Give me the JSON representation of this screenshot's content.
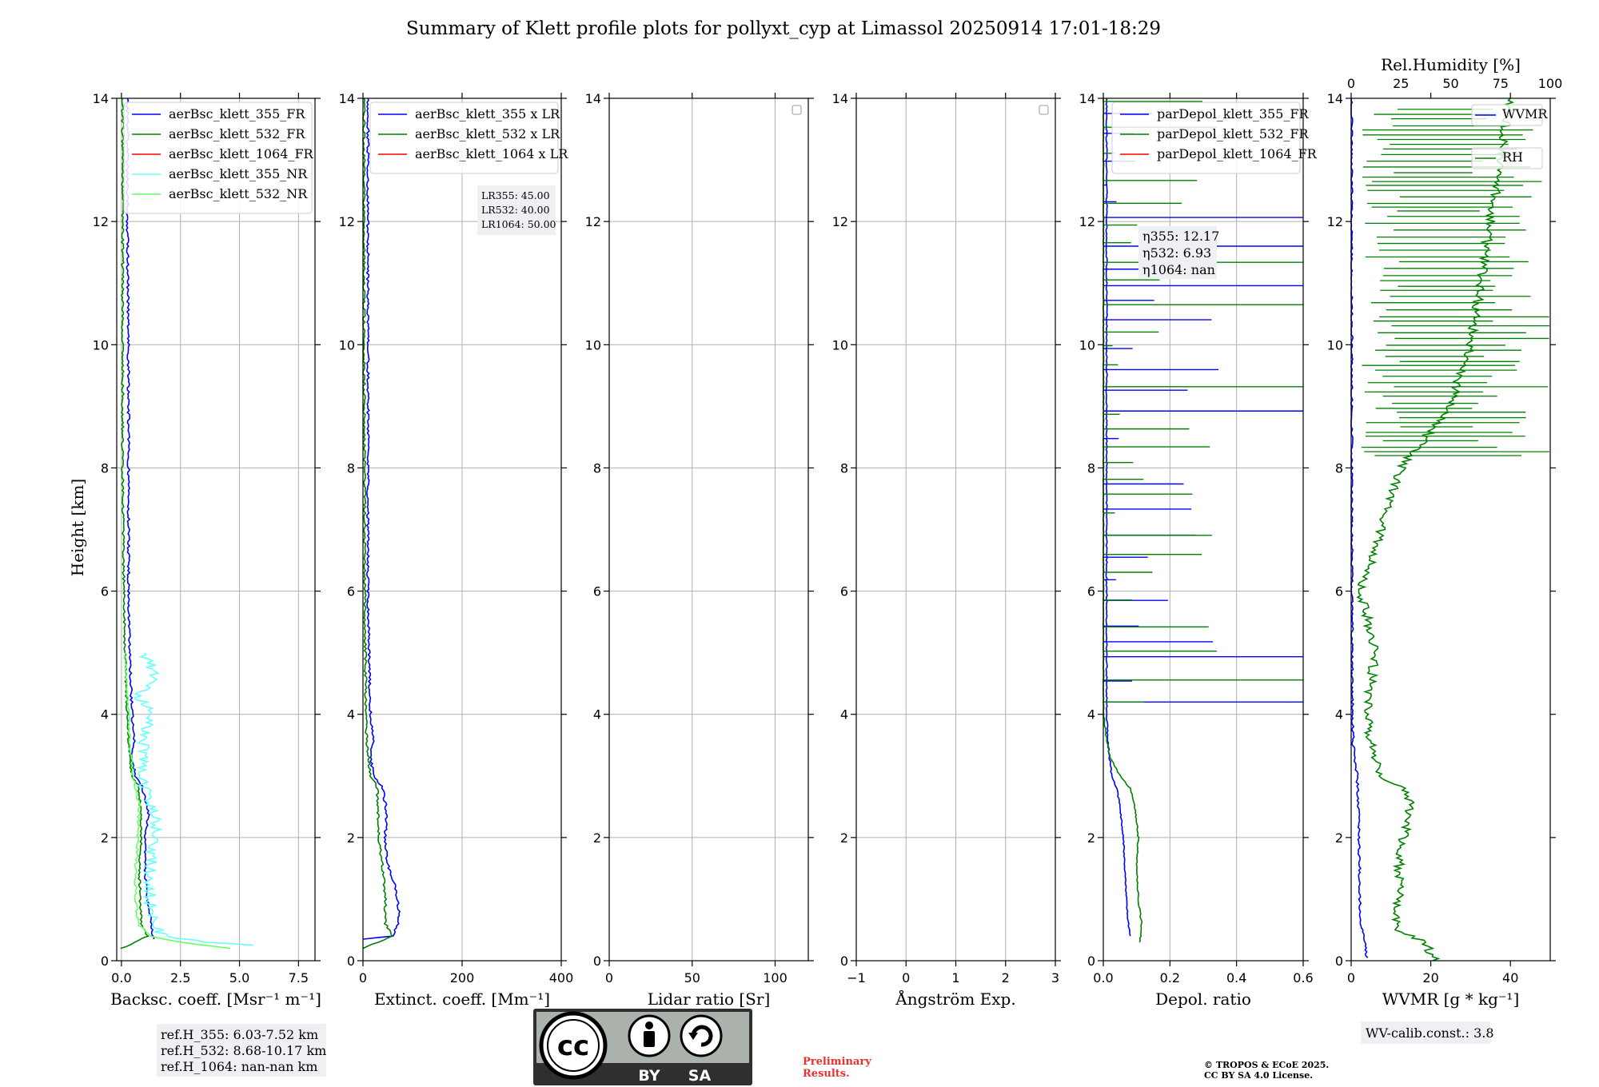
{
  "title": "Summary of Klett profile plots for pollyxt_cyp at Limassol 20250914 17:01-18:29",
  "y_label": "Height [km]",
  "colors": {
    "b355": "#0000ff",
    "b532": "#008000",
    "b1064": "#ff0000",
    "nr355": "#66ffff",
    "nr532": "#66ff66"
  },
  "chart_data": [
    {
      "type": "line",
      "id": "bsc",
      "xlabel": "Backsc. coeff. [Msr⁻¹ m⁻¹]",
      "xlim": [
        -0.2,
        8.2
      ],
      "ylim": [
        0,
        14
      ],
      "grid": true,
      "legend": "top-right",
      "xticks": [
        "0.0",
        "2.5",
        "5.0",
        "7.5"
      ],
      "yticks": [
        "0",
        "2",
        "4",
        "6",
        "8",
        "10",
        "12",
        "14"
      ],
      "series": [
        {
          "name": "aerBsc_klett_355_FR",
          "color": "#0000ff",
          "profile": [
            [
              0.35,
              1.35
            ],
            [
              0.5,
              1.3
            ],
            [
              0.75,
              1.2
            ],
            [
              1.0,
              1.1
            ],
            [
              1.5,
              1.0
            ],
            [
              2.0,
              1.0
            ],
            [
              2.4,
              1.15
            ],
            [
              2.8,
              0.9
            ],
            [
              3.0,
              0.6
            ],
            [
              3.3,
              0.4
            ],
            [
              3.6,
              0.55
            ],
            [
              4.0,
              0.45
            ],
            [
              5.0,
              0.35
            ],
            [
              6.0,
              0.3
            ],
            [
              7.0,
              0.3
            ],
            [
              8.0,
              0.3
            ],
            [
              10.0,
              0.3
            ],
            [
              12.0,
              0.25
            ],
            [
              14.0,
              0.25
            ]
          ]
        },
        {
          "name": "aerBsc_klett_532_FR",
          "color": "#008000",
          "profile": [
            [
              0.2,
              0.0
            ],
            [
              0.3,
              0.6
            ],
            [
              0.4,
              1.1
            ],
            [
              0.6,
              0.85
            ],
            [
              1.0,
              0.8
            ],
            [
              1.5,
              0.75
            ],
            [
              2.0,
              0.85
            ],
            [
              2.5,
              0.8
            ],
            [
              2.85,
              0.7
            ],
            [
              3.0,
              0.45
            ],
            [
              3.5,
              0.3
            ],
            [
              4.0,
              0.25
            ],
            [
              5.0,
              0.15
            ],
            [
              6.0,
              0.1
            ],
            [
              8.0,
              0.05
            ],
            [
              10.0,
              0.05
            ],
            [
              14.0,
              0.05
            ]
          ]
        },
        {
          "name": "aerBsc_klett_1064_FR",
          "color": "#ff0000",
          "profile": []
        },
        {
          "name": "aerBsc_klett_355_NR",
          "color": "#66ffff",
          "profile": [
            [
              0.25,
              5.8
            ],
            [
              0.3,
              3.5
            ],
            [
              0.4,
              1.8
            ],
            [
              0.6,
              1.3
            ],
            [
              1.0,
              1.2
            ],
            [
              1.5,
              1.25
            ],
            [
              2.0,
              1.35
            ],
            [
              2.3,
              1.5
            ],
            [
              2.7,
              1.1
            ],
            [
              3.0,
              0.8
            ],
            [
              3.3,
              1.0
            ],
            [
              3.6,
              0.9
            ],
            [
              4.0,
              1.3
            ],
            [
              4.3,
              0.7
            ],
            [
              4.6,
              1.4
            ],
            [
              5.0,
              1.0
            ]
          ]
        },
        {
          "name": "aerBsc_klett_532_NR",
          "color": "#66ff66",
          "profile": [
            [
              0.2,
              4.6
            ],
            [
              0.3,
              2.5
            ],
            [
              0.4,
              1.2
            ],
            [
              0.6,
              0.7
            ],
            [
              1.0,
              0.6
            ],
            [
              1.5,
              0.6
            ],
            [
              2.0,
              0.7
            ],
            [
              2.5,
              0.75
            ],
            [
              3.0,
              0.5
            ],
            [
              3.5,
              0.35
            ],
            [
              4.0,
              0.3
            ],
            [
              5.0,
              0.15
            ]
          ]
        }
      ],
      "annotation": [
        "ref.H_355: 6.03-7.52 km",
        "ref.H_532: 8.68-10.17 km",
        "ref.H_1064: nan-nan km"
      ]
    },
    {
      "type": "line",
      "id": "ext",
      "xlabel": "Extinct. coeff. [Mm⁻¹]",
      "xlim": [
        0,
        400
      ],
      "ylim": [
        0,
        14
      ],
      "grid": true,
      "legend": "top-right",
      "xticks": [
        "0",
        "200",
        "400"
      ],
      "yticks": [
        "0",
        "2",
        "4",
        "6",
        "8",
        "10",
        "12",
        "14"
      ],
      "series": [
        {
          "name": "aerBsc_klett_355 x LR",
          "color": "#0000ff",
          "profile": [
            [
              0.35,
              0
            ],
            [
              0.4,
              60
            ],
            [
              0.6,
              70
            ],
            [
              0.8,
              72
            ],
            [
              1.0,
              70
            ],
            [
              1.3,
              62
            ],
            [
              1.6,
              48
            ],
            [
              2.0,
              45
            ],
            [
              2.4,
              48
            ],
            [
              2.8,
              40
            ],
            [
              3.0,
              22
            ],
            [
              3.3,
              15
            ],
            [
              3.6,
              22
            ],
            [
              4.0,
              15
            ],
            [
              5.0,
              12
            ],
            [
              6.0,
              10
            ],
            [
              8.0,
              10
            ],
            [
              10.0,
              10
            ],
            [
              12.0,
              10
            ],
            [
              14.0,
              10
            ]
          ]
        },
        {
          "name": "aerBsc_klett_532 x LR",
          "color": "#008000",
          "profile": [
            [
              0.2,
              0
            ],
            [
              0.4,
              60
            ],
            [
              0.6,
              45
            ],
            [
              1.0,
              45
            ],
            [
              1.5,
              40
            ],
            [
              2.0,
              32
            ],
            [
              2.5,
              30
            ],
            [
              2.85,
              28
            ],
            [
              3.0,
              15
            ],
            [
              3.5,
              8
            ],
            [
              4.0,
              6
            ],
            [
              6.0,
              4
            ],
            [
              10.0,
              2
            ],
            [
              14.0,
              2
            ]
          ]
        },
        {
          "name": "aerBsc_klett_1064 x LR",
          "color": "#ff0000",
          "profile": []
        }
      ],
      "annotation": [
        "LR355: 45.00",
        "LR532: 40.00",
        "LR1064: 50.00"
      ]
    },
    {
      "type": "line",
      "id": "lr",
      "xlabel": "Lidar ratio [Sr]",
      "xlim": [
        0,
        120
      ],
      "ylim": [
        0,
        14
      ],
      "grid": true,
      "legend": "top-right",
      "xticks": [
        "0",
        "50",
        "100"
      ],
      "yticks": [
        "0",
        "2",
        "4",
        "6",
        "8",
        "10",
        "12",
        "14"
      ],
      "series": []
    },
    {
      "type": "line",
      "id": "ang",
      "xlabel": "Ångström Exp.",
      "xlim": [
        -1,
        3
      ],
      "ylim": [
        0,
        14
      ],
      "grid": true,
      "legend": "top-right",
      "xticks": [
        "−1",
        "0",
        "1",
        "2",
        "3"
      ],
      "yticks": [
        "0",
        "2",
        "4",
        "6",
        "8",
        "10",
        "12",
        "14"
      ],
      "series": []
    },
    {
      "type": "line",
      "id": "dep",
      "xlabel": "Depol. ratio",
      "xlim": [
        0,
        0.6
      ],
      "ylim": [
        0,
        14
      ],
      "grid": true,
      "legend": "top-right",
      "xticks": [
        "0.0",
        "0.2",
        "0.4",
        "0.6"
      ],
      "yticks": [
        "0",
        "2",
        "4",
        "6",
        "8",
        "10",
        "12",
        "14"
      ],
      "series": [
        {
          "name": "parDepol_klett_355_FR",
          "color": "#0000ff",
          "profile": [
            [
              0.4,
              0.08
            ],
            [
              0.6,
              0.075
            ],
            [
              1.0,
              0.07
            ],
            [
              1.5,
              0.065
            ],
            [
              2.0,
              0.06
            ],
            [
              2.5,
              0.05
            ],
            [
              2.8,
              0.04
            ],
            [
              3.0,
              0.025
            ],
            [
              3.5,
              0.015
            ],
            [
              4.0,
              0.01
            ],
            [
              5.0,
              0.01
            ],
            [
              14.0,
              0.01
            ]
          ]
        },
        {
          "name": "parDepol_klett_532_FR",
          "color": "#008000",
          "profile": [
            [
              0.3,
              0.11
            ],
            [
              0.6,
              0.115
            ],
            [
              1.0,
              0.105
            ],
            [
              1.5,
              0.1
            ],
            [
              2.0,
              0.105
            ],
            [
              2.5,
              0.095
            ],
            [
              2.8,
              0.08
            ],
            [
              3.0,
              0.05
            ],
            [
              3.3,
              0.02
            ],
            [
              3.6,
              0.01
            ],
            [
              4.0,
              0.0
            ],
            [
              14.0,
              0.0
            ]
          ]
        },
        {
          "name": "parDepol_klett_1064_FR",
          "color": "#ff0000",
          "profile": []
        }
      ],
      "annotation": [
        "η355: 12.17",
        "η532: 6.93",
        "η1064: nan"
      ]
    },
    {
      "type": "line",
      "id": "wv",
      "xlabel": "WVMR [g * kg⁻¹]",
      "x2label": "Rel.Humidity [%]",
      "xlim": [
        0,
        50
      ],
      "x2lim": [
        0,
        100
      ],
      "ylim": [
        0,
        14
      ],
      "grid": false,
      "legend": "top-right",
      "xticks": [
        "0",
        "20",
        "40"
      ],
      "x2ticks": [
        "0",
        "25",
        "50",
        "75",
        "100"
      ],
      "yticks": [
        "0",
        "2",
        "4",
        "6",
        "8",
        "10",
        "12",
        "14"
      ],
      "series": [
        {
          "name": "WVMR",
          "color": "#0000ff",
          "profile": [
            [
              0.05,
              4.0
            ],
            [
              0.3,
              3.5
            ],
            [
              0.6,
              2.5
            ],
            [
              1.0,
              2.2
            ],
            [
              2.0,
              2.0
            ],
            [
              3.0,
              1.5
            ],
            [
              3.5,
              0.5
            ],
            [
              4.0,
              0.3
            ],
            [
              6.0,
              0.2
            ],
            [
              10.0,
              0.1
            ],
            [
              14.0,
              0.1
            ]
          ]
        },
        {
          "name": "RH",
          "color": "#008000",
          "profile": [
            [
              0.0,
              42
            ],
            [
              0.3,
              37
            ],
            [
              0.5,
              22
            ],
            [
              1.0,
              24
            ],
            [
              1.5,
              24
            ],
            [
              2.0,
              26
            ],
            [
              2.5,
              30
            ],
            [
              2.8,
              26
            ],
            [
              3.0,
              15
            ],
            [
              3.5,
              10
            ],
            [
              4.0,
              8
            ],
            [
              5.0,
              12
            ],
            [
              6.0,
              5
            ],
            [
              7.0,
              15
            ],
            [
              8.0,
              25
            ],
            [
              9.0,
              50
            ],
            [
              10.0,
              60
            ],
            [
              12.0,
              70
            ],
            [
              14.0,
              80
            ]
          ]
        }
      ],
      "annotation": [
        "WV-calib.const.: 3.8"
      ]
    }
  ],
  "logo": {
    "text_by": "BY",
    "text_sa": "SA",
    "text_cc": "cc"
  },
  "preliminary": [
    "Preliminary",
    "Results."
  ],
  "copyright": [
    "© TROPOS & ECoE 2025.",
    "CC BY SA 4.0 License."
  ]
}
